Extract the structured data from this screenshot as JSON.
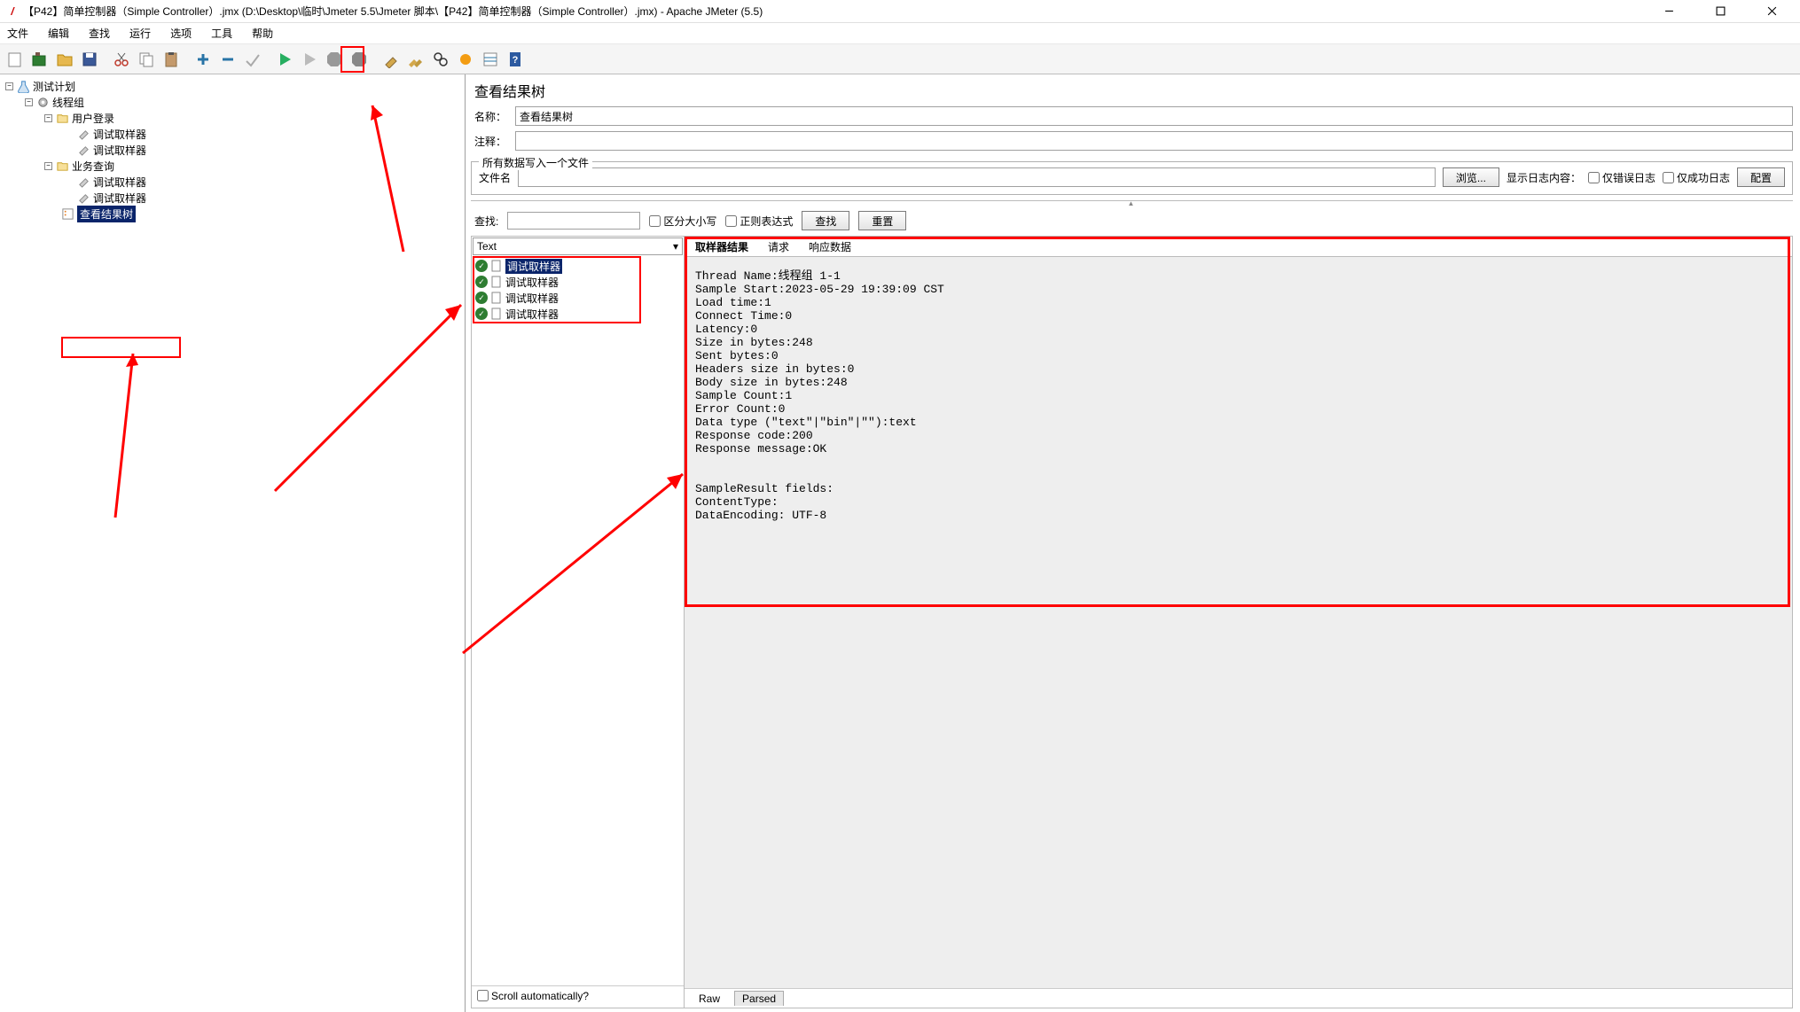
{
  "window": {
    "title": "【P42】简单控制器（Simple Controller）.jmx (D:\\Desktop\\临时\\Jmeter 5.5\\Jmeter 脚本\\【P42】简单控制器（Simple Controller）.jmx) - Apache JMeter (5.5)"
  },
  "menu": [
    "文件",
    "编辑",
    "查找",
    "运行",
    "选项",
    "工具",
    "帮助"
  ],
  "tree": {
    "test_plan": "测试计划",
    "thread_group": "线程组",
    "controller1": "用户登录",
    "sampler1a": "调试取样器",
    "sampler1b": "调试取样器",
    "controller2": "业务查询",
    "sampler2a": "调试取样器",
    "sampler2b": "调试取样器",
    "results_tree": "查看结果树"
  },
  "panel": {
    "title": "查看结果树",
    "name_label": "名称：",
    "name_value": "查看结果树",
    "comment_label": "注释：",
    "comment_value": "",
    "fieldset_legend": "所有数据写入一个文件",
    "filename_label": "文件名",
    "filename_value": "",
    "browse_btn": "浏览...",
    "log_hint": "显示日志内容：",
    "only_errors": "仅错误日志",
    "only_success": "仅成功日志",
    "config_btn": "配置",
    "search_label": "查找:",
    "case_sensitive": "区分大小写",
    "regex": "正则表达式",
    "search_btn": "查找",
    "reset_btn": "重置",
    "renderer": "Text",
    "samples": [
      "调试取样器",
      "调试取样器",
      "调试取样器",
      "调试取样器"
    ],
    "scroll_auto": "Scroll automatically?",
    "detail_tabs": [
      "取样器结果",
      "请求",
      "响应数据"
    ],
    "bottom_tabs": [
      "Raw",
      "Parsed"
    ],
    "detail_text": "Thread Name:线程组 1-1\nSample Start:2023-05-29 19:39:09 CST\nLoad time:1\nConnect Time:0\nLatency:0\nSize in bytes:248\nSent bytes:0\nHeaders size in bytes:0\nBody size in bytes:248\nSample Count:1\nError Count:0\nData type (\"text\"|\"bin\"|\"\"):text\nResponse code:200\nResponse message:OK\n\n\nSampleResult fields:\nContentType: \nDataEncoding: UTF-8"
  }
}
